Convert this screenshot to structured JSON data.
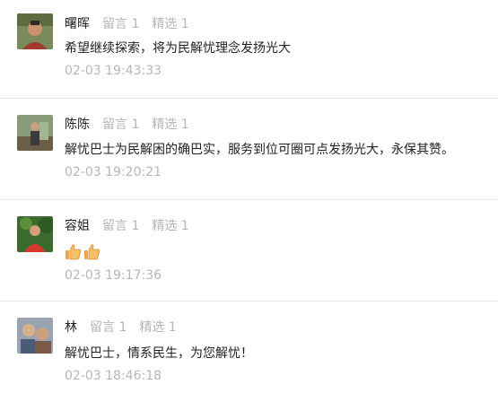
{
  "comments": [
    {
      "nickname": "曙晖",
      "likes_label": "留言 1",
      "featured_label": "精选 1",
      "text": "希望继续探索，将为民解忧理念发扬光大",
      "time": "02-03 19:43:33",
      "avatar_icon": "user-avatar-photo"
    },
    {
      "nickname": "陈陈",
      "likes_label": "留言 1",
      "featured_label": "精选 1",
      "text": "解忧巴士为民解困的确巴实，服务到位可圈可点发扬光大，永保其赞。",
      "time": "02-03 19:20:21",
      "avatar_icon": "user-avatar-photo"
    },
    {
      "nickname": "容姐",
      "likes_label": "留言 1",
      "featured_label": "精选 1",
      "text": "",
      "emojis": [
        "thumbs-up-icon",
        "thumbs-up-icon"
      ],
      "time": "02-03 19:17:36",
      "avatar_icon": "user-avatar-photo"
    },
    {
      "nickname": "林",
      "likes_label": "留言 1",
      "featured_label": "精选 1",
      "text": "解忧巴士，情系民生，为您解忧！",
      "time": "02-03 18:46:18",
      "avatar_icon": "user-avatar-photo"
    }
  ],
  "colors": {
    "text": "#222222",
    "muted": "#b5b5b5",
    "divider": "#e9e9e9"
  }
}
